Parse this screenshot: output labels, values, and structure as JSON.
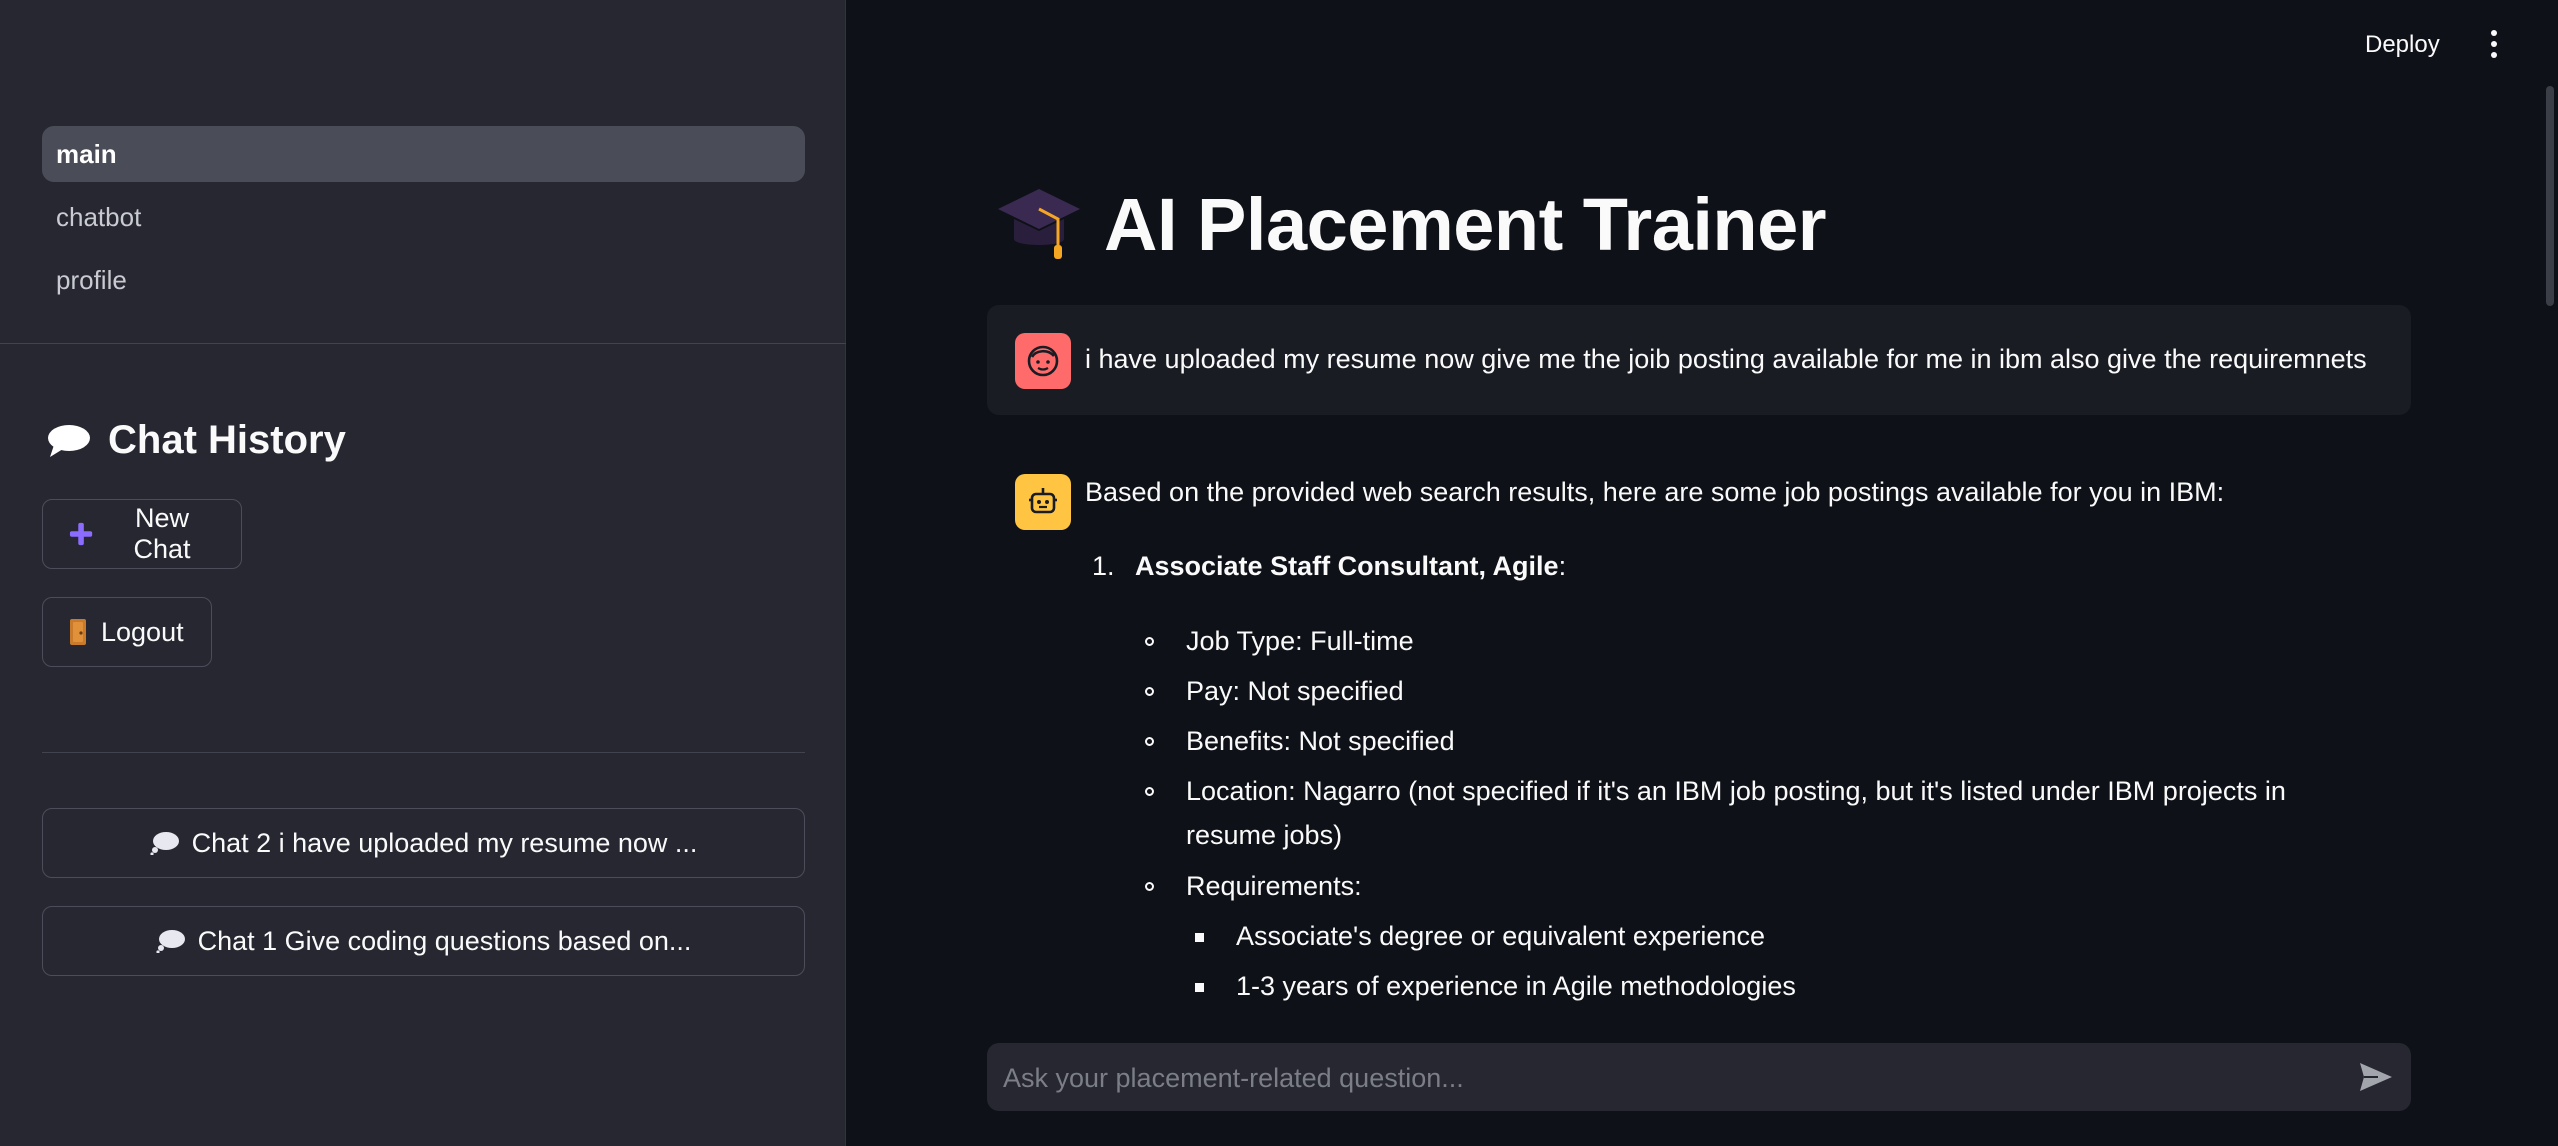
{
  "sidebar": {
    "nav": [
      {
        "label": "main",
        "active": true
      },
      {
        "label": "chatbot",
        "active": false
      },
      {
        "label": "profile",
        "active": false
      }
    ],
    "history_title": "Chat History",
    "new_chat_label": "New Chat",
    "logout_label": "Logout",
    "chats": [
      {
        "label": "Chat 2 i have uploaded my resume now ..."
      },
      {
        "label": "Chat 1 Give coding questions based on..."
      }
    ]
  },
  "header": {
    "deploy_label": "Deploy",
    "menu_icon": "kebab-menu-icon"
  },
  "main": {
    "title": "AI Placement Trainer",
    "title_icon": "graduation-cap-icon",
    "messages": {
      "user": "i have uploaded my resume now give me the joib posting available for me in ibm also give the requiremnets",
      "assistant_intro": "Based on the provided web search results, here are some job postings available for you in IBM:",
      "item_number": "1.",
      "item_title": "Associate Staff Consultant, Agile",
      "item_colon": ":",
      "details": [
        "Job Type: Full-time",
        "Pay: Not specified",
        "Benefits: Not specified",
        "Location: Nagarro (not specified if it's an IBM job posting, but it's listed under IBM projects in resume jobs)",
        "Requirements:"
      ],
      "requirements": [
        "Associate's degree or equivalent experience",
        "1-3 years of experience in Agile methodologies"
      ]
    },
    "input_placeholder": "Ask your placement-related question..."
  },
  "colors": {
    "background": "#0e1117",
    "sidebar": "#262730",
    "user_avatar": "#ff6b6b",
    "bot_avatar": "#ffc542",
    "accent_plus": "#8b6cff"
  }
}
